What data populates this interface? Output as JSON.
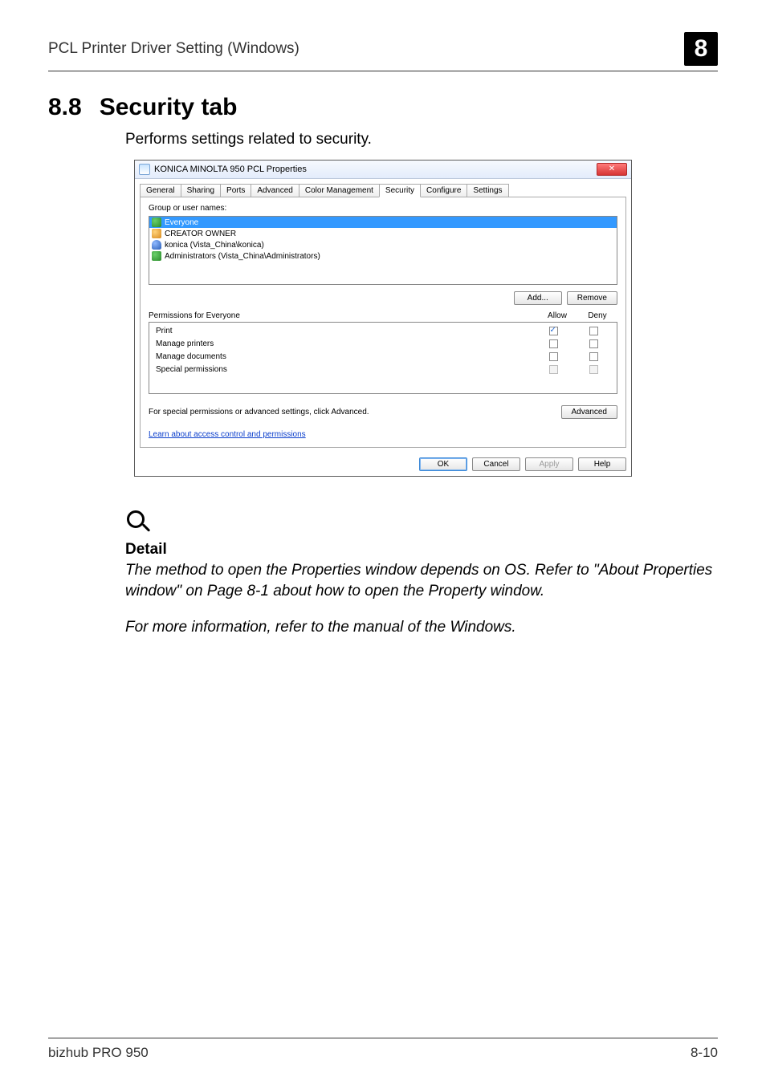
{
  "header": {
    "title": "PCL Printer Driver Setting (Windows)",
    "chapter": "8"
  },
  "section": {
    "number": "8.8",
    "title": "Security tab"
  },
  "intro": "Performs settings related to security.",
  "dialog": {
    "title": "KONICA MINOLTA 950 PCL Properties",
    "close_glyph": "✕",
    "tabs": [
      "General",
      "Sharing",
      "Ports",
      "Advanced",
      "Color Management",
      "Security",
      "Configure",
      "Settings"
    ],
    "active_tab_index": 5,
    "group_label": "Group or user names:",
    "users": [
      {
        "name": "Everyone",
        "type": "group",
        "selected": true
      },
      {
        "name": "CREATOR OWNER",
        "type": "owner",
        "selected": false
      },
      {
        "name": "konica (Vista_China\\konica)",
        "type": "user",
        "selected": false
      },
      {
        "name": "Administrators (Vista_China\\Administrators)",
        "type": "group",
        "selected": false
      }
    ],
    "buttons": {
      "add": "Add...",
      "remove": "Remove",
      "advanced": "Advanced"
    },
    "perm_header": {
      "label": "Permissions for Everyone",
      "allow": "Allow",
      "deny": "Deny"
    },
    "permissions": [
      {
        "label": "Print",
        "allow": true,
        "deny": false,
        "disabled": false
      },
      {
        "label": "Manage printers",
        "allow": false,
        "deny": false,
        "disabled": false
      },
      {
        "label": "Manage documents",
        "allow": false,
        "deny": false,
        "disabled": false
      },
      {
        "label": "Special permissions",
        "allow": false,
        "deny": false,
        "disabled": true
      }
    ],
    "advanced_text": "For special permissions or advanced settings, click Advanced.",
    "link_text": "Learn about access control and permissions",
    "footer": {
      "ok": "OK",
      "cancel": "Cancel",
      "apply": "Apply",
      "help": "Help"
    }
  },
  "detail": {
    "heading": "Detail",
    "para1": "The method to open the Properties window depends on OS. Refer to \"About Properties window\" on Page 8-1 about how to open the Property window.",
    "para2": "For more information, refer to the manual of the Windows."
  },
  "page_footer": {
    "left": "bizhub PRO 950",
    "right": "8-10"
  }
}
